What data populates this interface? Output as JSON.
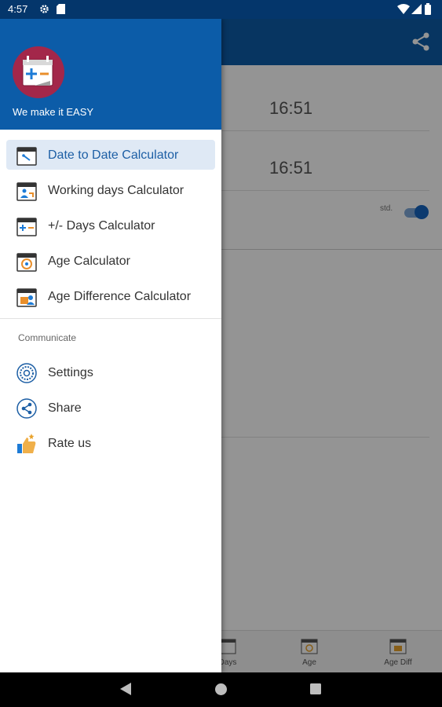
{
  "status_bar": {
    "time": "4:57"
  },
  "drawer": {
    "tagline": "We make it EASY",
    "items": [
      {
        "label": "Date to Date Calculator",
        "icon": "calendar-date-icon",
        "active": true
      },
      {
        "label": "Working days Calculator",
        "icon": "calendar-working-icon"
      },
      {
        "label": "+/- Days Calculator",
        "icon": "calendar-plus-minus-icon"
      },
      {
        "label": "Age Calculator",
        "icon": "calendar-age-icon"
      },
      {
        "label": "Age Difference Calculator",
        "icon": "calendar-age-diff-icon"
      }
    ],
    "section_title": "Communicate",
    "communicate_items": [
      {
        "label": "Settings",
        "icon": "settings-icon"
      },
      {
        "label": "Share",
        "icon": "share-icon"
      },
      {
        "label": "Rate us",
        "icon": "rate-us-icon"
      }
    ]
  },
  "background": {
    "time1": "16:51",
    "time2": "16:51",
    "toggle_label": "std.",
    "bottom_nav": [
      "Days",
      "Age",
      "Age Diff"
    ]
  },
  "colors": {
    "primary": "#0c5ca8",
    "status_bar": "#04366b",
    "logo_bg": "#a3274a",
    "active_highlight": "#dfe9f5"
  }
}
